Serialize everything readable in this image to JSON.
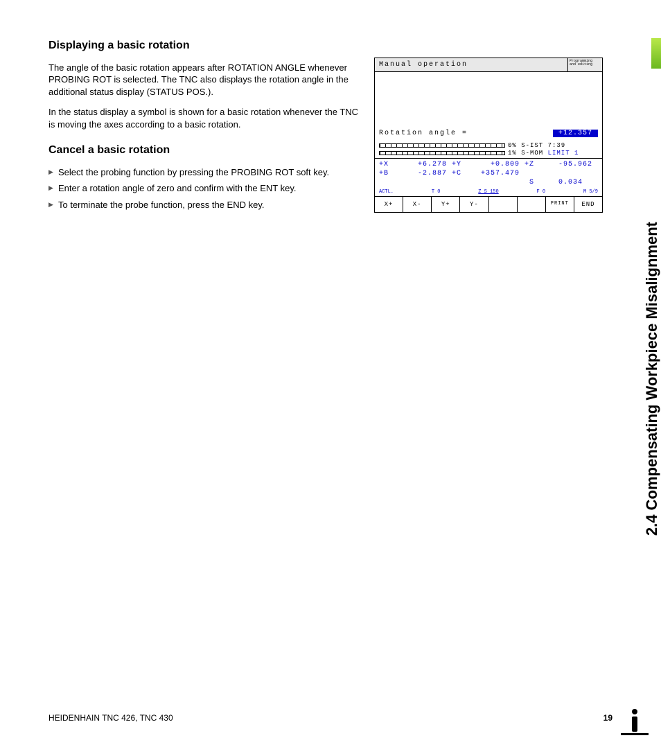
{
  "headings": {
    "h1": "Displaying a basic rotation",
    "h2": "Cancel a basic rotation"
  },
  "paragraphs": {
    "p1": "The angle of the basic rotation appears after ROTATION ANGLE whenever PROBING ROT is selected. The TNC also displays the rotation angle in the additional status display (STATUS POS.).",
    "p2": "In the status display a symbol is shown for a basic rotation whenever the TNC is moving the axes according to a basic rotation."
  },
  "bullets": [
    "Select the probing function by pressing the PROBING ROT soft key.",
    "Enter a rotation angle of zero and confirm with the ENT key.",
    "To terminate the probe function, press the END key."
  ],
  "tnc": {
    "title": "Manual operation",
    "mode1": "Programming",
    "mode2": "and editing",
    "rot_label": "Rotation angle =",
    "rot_value": "+12.357",
    "bar1": "0% S-IST 7:39",
    "bar2_a": "1% S-MOM ",
    "bar2_b": "LIMIT 1",
    "coords": "+X      +6.278 +Y      +0.809 +Z     -95.962\n+B      -2.887 +C    +357.479\n                               S     0.034",
    "status": {
      "a": "ACTL.",
      "b": "T 0",
      "c": "Z S 150",
      "d": "F 0",
      "e": "M 5/9"
    },
    "softkeys": [
      "X+",
      "X-",
      "Y+",
      "Y-",
      "",
      "",
      "PRINT",
      "END"
    ]
  },
  "side_title": "2.4 Compensating Workpiece Misalignment",
  "footer": {
    "left": "HEIDENHAIN TNC 426, TNC 430",
    "page": "19"
  }
}
